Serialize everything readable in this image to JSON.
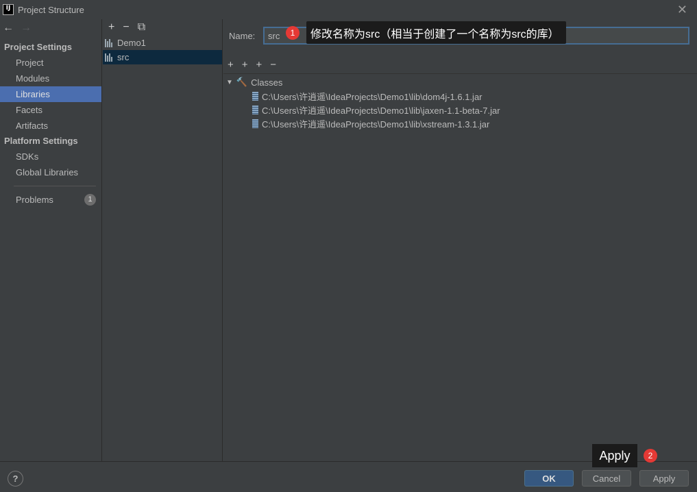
{
  "window": {
    "title": "Project Structure",
    "app_icon_text": "IJ",
    "close_glyph": "✕"
  },
  "nav": {
    "back_glyph": "←",
    "forward_glyph": "→",
    "project_settings_heading": "Project Settings",
    "project_settings_items": [
      "Project",
      "Modules",
      "Libraries",
      "Facets",
      "Artifacts"
    ],
    "platform_settings_heading": "Platform Settings",
    "platform_settings_items": [
      "SDKs",
      "Global Libraries"
    ],
    "problems_label": "Problems",
    "problems_count": "1",
    "selected_item": "Libraries"
  },
  "libraries": {
    "toolbar": {
      "add": "+",
      "remove": "−",
      "copy": "⧉"
    },
    "items": [
      {
        "label": "Demo1"
      },
      {
        "label": "src"
      }
    ],
    "selected": "src"
  },
  "detail": {
    "name_label": "Name:",
    "name_value": "src",
    "toolbar": {
      "add": "+",
      "add_alt": "+",
      "add_external": "+",
      "remove": "−"
    },
    "tree_root_label": "Classes",
    "tree_children": [
      "C:\\Users\\许逍遥\\IdeaProjects\\Demo1\\lib\\dom4j-1.6.1.jar",
      "C:\\Users\\许逍遥\\IdeaProjects\\Demo1\\lib\\jaxen-1.1-beta-7.jar",
      "C:\\Users\\许逍遥\\IdeaProjects\\Demo1\\lib\\xstream-1.3.1.jar"
    ]
  },
  "annotations": {
    "step1_number": "1",
    "step1_text": "修改名称为src（相当于创建了一个名称为src的库）",
    "step2_number": "2",
    "step2_text": "Apply"
  },
  "footer": {
    "help_glyph": "?",
    "ok_label": "OK",
    "cancel_label": "Cancel",
    "apply_label": "Apply"
  },
  "colors": {
    "background": "#3c3f41",
    "selection": "#4b6eaf",
    "list_selection": "#0d293e",
    "ok_button": "#365880",
    "annotation_marker": "#e53935"
  }
}
